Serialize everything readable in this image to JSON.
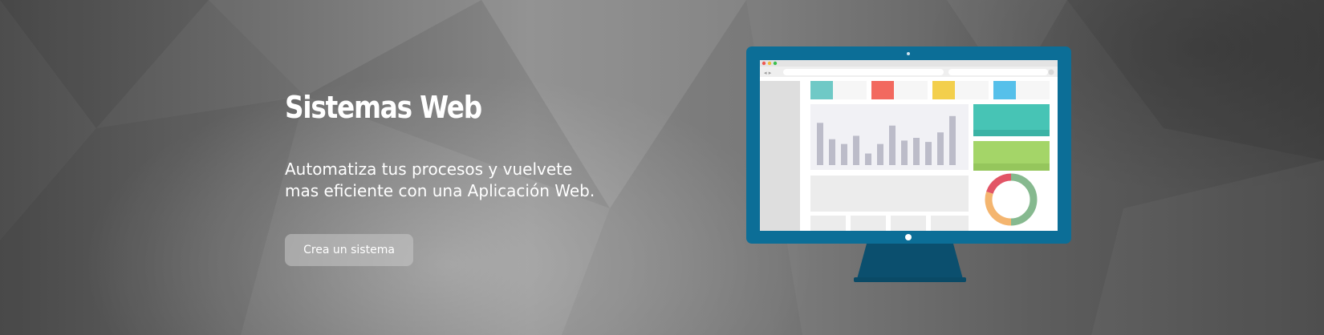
{
  "hero": {
    "headline": "Sistemas Web",
    "subline_1": "Automatiza tus procesos y vuelvete",
    "subline_2": "mas eficiente con una Aplicación Web.",
    "cta_label": "Crea un sistema"
  },
  "colors": {
    "monitor_frame": "#0c6e97",
    "monitor_stand": "#0b4f6e",
    "tile_teal": "#6fc9c6",
    "tile_red": "#f2695f",
    "tile_yellow": "#f3cf4c",
    "tile_blue": "#56c0ea",
    "panel_teal": "#47c4b5",
    "panel_green": "#a4d568",
    "donut_green": "#86b98f",
    "donut_orange": "#f4b56f",
    "donut_red": "#e25566",
    "bars": "#bcbcc9"
  },
  "chart_data": {
    "type": "bar",
    "values": [
      62,
      38,
      31,
      43,
      17,
      31,
      58,
      36,
      40,
      34,
      48,
      72
    ],
    "ylim": [
      0,
      80
    ]
  },
  "donut": {
    "values": [
      0.5,
      0.3,
      0.2
    ]
  }
}
